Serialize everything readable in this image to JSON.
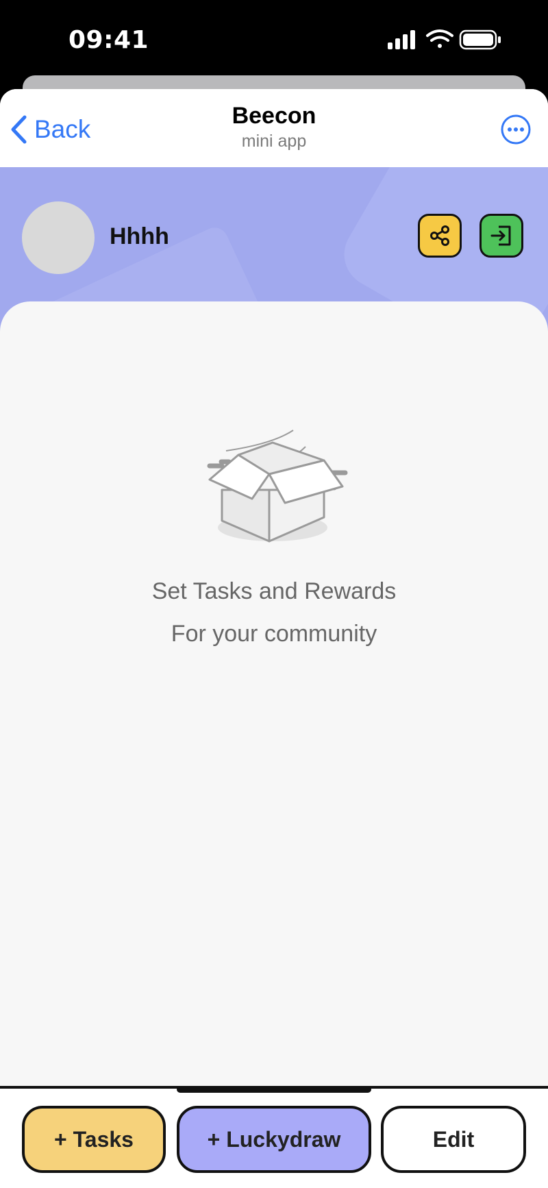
{
  "status_bar": {
    "time": "09:41"
  },
  "nav": {
    "back_label": "Back",
    "title": "Beecon",
    "subtitle": "mini app"
  },
  "profile": {
    "name": "Hhhh"
  },
  "empty_state": {
    "line1": "Set Tasks and Rewards",
    "line2": "For your community"
  },
  "actions": {
    "tasks_label": "+ Tasks",
    "luckydraw_label": "+ Luckydraw",
    "edit_label": "Edit"
  },
  "colors": {
    "hero_bg": "#a1a9ee",
    "share_button": "#f6c944",
    "exit_button": "#4ec25a",
    "tasks_button": "#f6d27b",
    "luckydraw_button": "#a9aaf8",
    "link_blue": "#3478f6"
  }
}
